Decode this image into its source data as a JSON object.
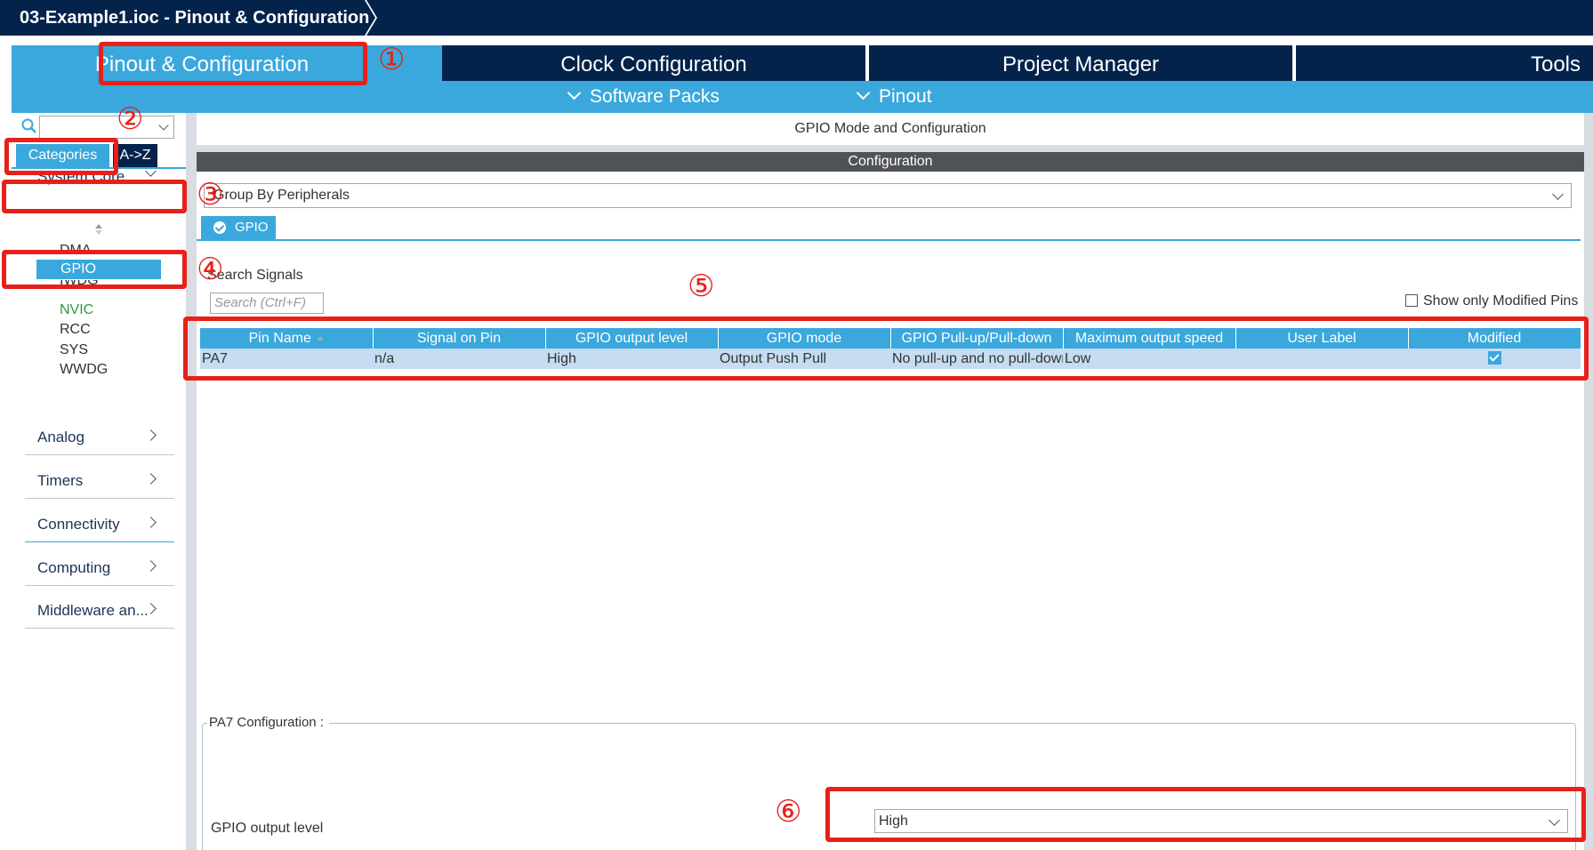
{
  "window": {
    "title": "03-Example1.ioc - Pinout & Configuration"
  },
  "tabs": [
    {
      "label": "Pinout & Configuration"
    },
    {
      "label": "Clock Configuration"
    },
    {
      "label": "Project Manager"
    },
    {
      "label": "Tools"
    }
  ],
  "subnav": {
    "software_packs": "Software Packs",
    "pinout": "Pinout"
  },
  "left": {
    "categories_btn": "Categories",
    "az_btn": "A->Z",
    "system_core": "System Core",
    "system_core_items": [
      {
        "label": "DMA"
      },
      {
        "label": "GPIO"
      },
      {
        "label": "IWDG"
      },
      {
        "label": "NVIC"
      },
      {
        "label": "RCC"
      },
      {
        "label": "SYS"
      },
      {
        "label": "WWDG"
      }
    ],
    "categories": [
      {
        "label": "Analog"
      },
      {
        "label": "Timers"
      },
      {
        "label": "Connectivity"
      },
      {
        "label": "Computing"
      },
      {
        "label": "Middleware an..."
      }
    ]
  },
  "main": {
    "mode_title": "GPIO Mode and Configuration",
    "config_title": "Configuration",
    "group_select": "Group By Peripherals",
    "gpio_tab": "GPIO",
    "search_label": "Search Signals",
    "search_placeholder": "Search (Ctrl+F)",
    "show_modified": "Show only Modified Pins",
    "table": {
      "columns": [
        "Pin Name",
        "Signal on Pin",
        "GPIO output level",
        "GPIO mode",
        "GPIO Pull-up/Pull-down",
        "Maximum output speed",
        "User Label",
        "Modified"
      ],
      "rows": [
        [
          "PA7",
          "n/a",
          "High",
          "Output Push Pull",
          "No pull-up and no pull-down",
          "Low",
          "",
          "checked"
        ]
      ]
    },
    "pa7_config": "PA7 Configuration :",
    "output_level_label": "GPIO output level",
    "output_level_value": "High"
  },
  "annotations": [
    "①",
    "②",
    "③",
    "④",
    "⑤",
    "⑥"
  ],
  "colors": {
    "brand_dark": "#03234b",
    "accent": "#3aa8dc",
    "annotation": "#e8201a",
    "row_selected": "#c5dcf2"
  }
}
